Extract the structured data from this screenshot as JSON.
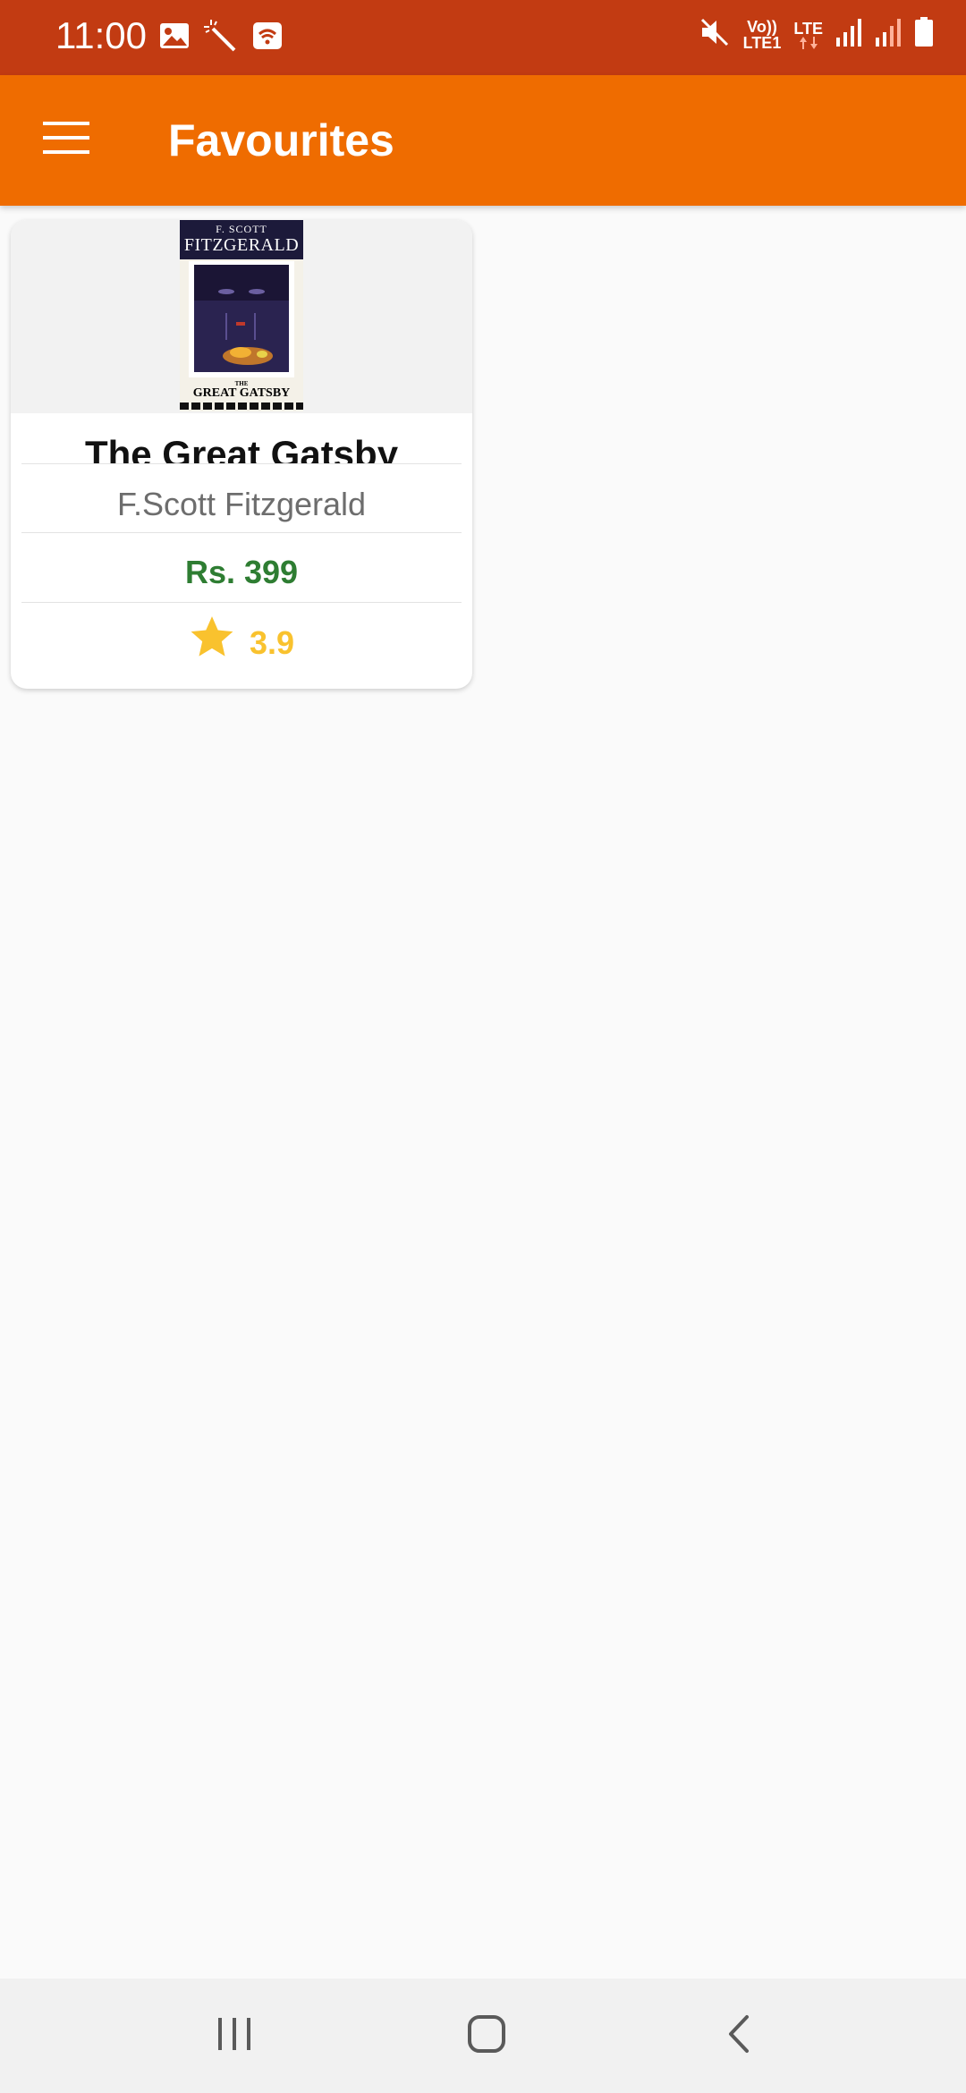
{
  "status_bar": {
    "time": "11:00",
    "left_icons": [
      "image-icon",
      "magic-wand-icon",
      "wifi-calling-icon"
    ],
    "right_icons": [
      "mute-icon",
      "volte-icon",
      "lte-icon",
      "signal-icon",
      "signal-icon",
      "battery-icon"
    ],
    "volte_label_top": "Vo))",
    "volte_label_bottom": "LTE1",
    "lte_label": "LTE"
  },
  "app_bar": {
    "title": "Favourites",
    "menu_icon": "menu-icon"
  },
  "favourites": [
    {
      "cover": {
        "author_small": "F. SCOTT",
        "author_big": "FITZGERALD",
        "title_the": "THE",
        "title_main": "GREAT GATSBY"
      },
      "title": "The Great Gatsby",
      "author": "F.Scott Fitzgerald",
      "price": "Rs. 399",
      "rating": "3.9",
      "rating_icon": "star-icon"
    }
  ],
  "colors": {
    "status_bar": "#c23b12",
    "app_bar": "#ef6c00",
    "price": "#2e7d32",
    "rating": "#f9c22e"
  },
  "nav_bar": {
    "buttons": [
      "recent-apps-icon",
      "home-icon",
      "back-icon"
    ]
  }
}
